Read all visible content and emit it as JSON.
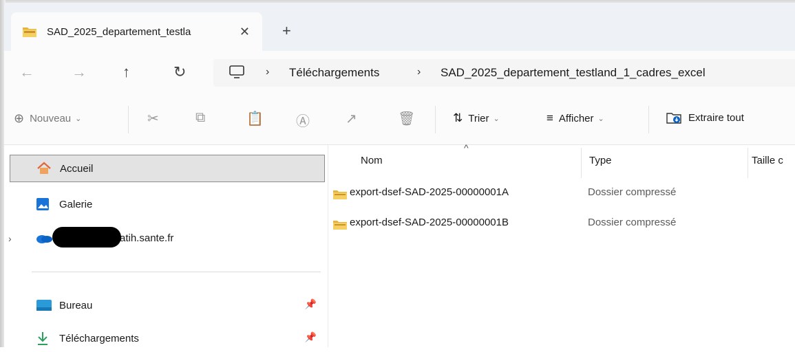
{
  "tab": {
    "title": "SAD_2025_departement_testla",
    "close": "✕",
    "new_tab": "+"
  },
  "nav": {
    "back": "←",
    "forward": "→",
    "up": "↑",
    "refresh": "↻",
    "breadcrumb": [
      "Téléchargements",
      "SAD_2025_departement_testland_1_cadres_excel"
    ],
    "separator": "›"
  },
  "toolbar": {
    "new_label": "Nouveau",
    "sort_label": "Trier",
    "view_label": "Afficher",
    "extract_label": "Extraire tout"
  },
  "sidebar": {
    "items": [
      {
        "label": "Accueil",
        "icon": "home-icon"
      },
      {
        "label": "Galerie",
        "icon": "gallery-icon"
      },
      {
        "label": "atih.sante.fr",
        "icon": "onedrive-icon"
      },
      {
        "label": "Bureau",
        "icon": "desktop-icon"
      },
      {
        "label": "Téléchargements",
        "icon": "download-icon"
      }
    ]
  },
  "columns": {
    "name": "Nom",
    "type": "Type",
    "size": "Taille c"
  },
  "files": [
    {
      "name": "export-dsef-SAD-2025-00000001A",
      "type": "Dossier compressé"
    },
    {
      "name": "export-dsef-SAD-2025-00000001B",
      "type": "Dossier compressé"
    }
  ],
  "colors": {
    "folder": "#e8b33a",
    "selected_bg": "#e3e3e3",
    "accent": "#0a62c4"
  }
}
